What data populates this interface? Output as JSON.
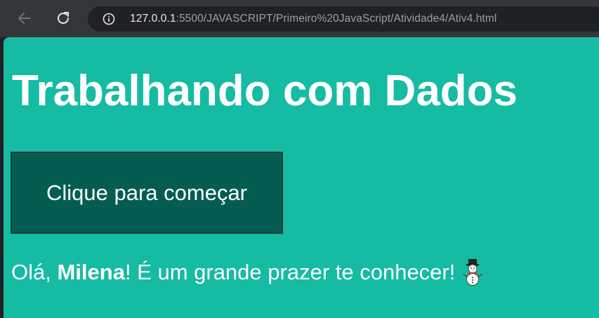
{
  "browser": {
    "url_host": "127.0.0.1",
    "url_path": ":5500/JAVASCRIPT/Primeiro%20JavaScript/Atividade4/Ativ4.html",
    "back_icon": "arrow-left-icon",
    "reload_icon": "reload-icon",
    "info_icon": "info-icon"
  },
  "page": {
    "title": "Trabalhando com Dados",
    "button_label": "Clique para começar",
    "greeting_prefix": "Olá, ",
    "greeting_name": "Milena",
    "greeting_suffix": "! É um grande prazer te conhecer!",
    "emoji_icon": "snowman-icon",
    "background_color": "#15bba2",
    "button_color": "#055d52"
  }
}
